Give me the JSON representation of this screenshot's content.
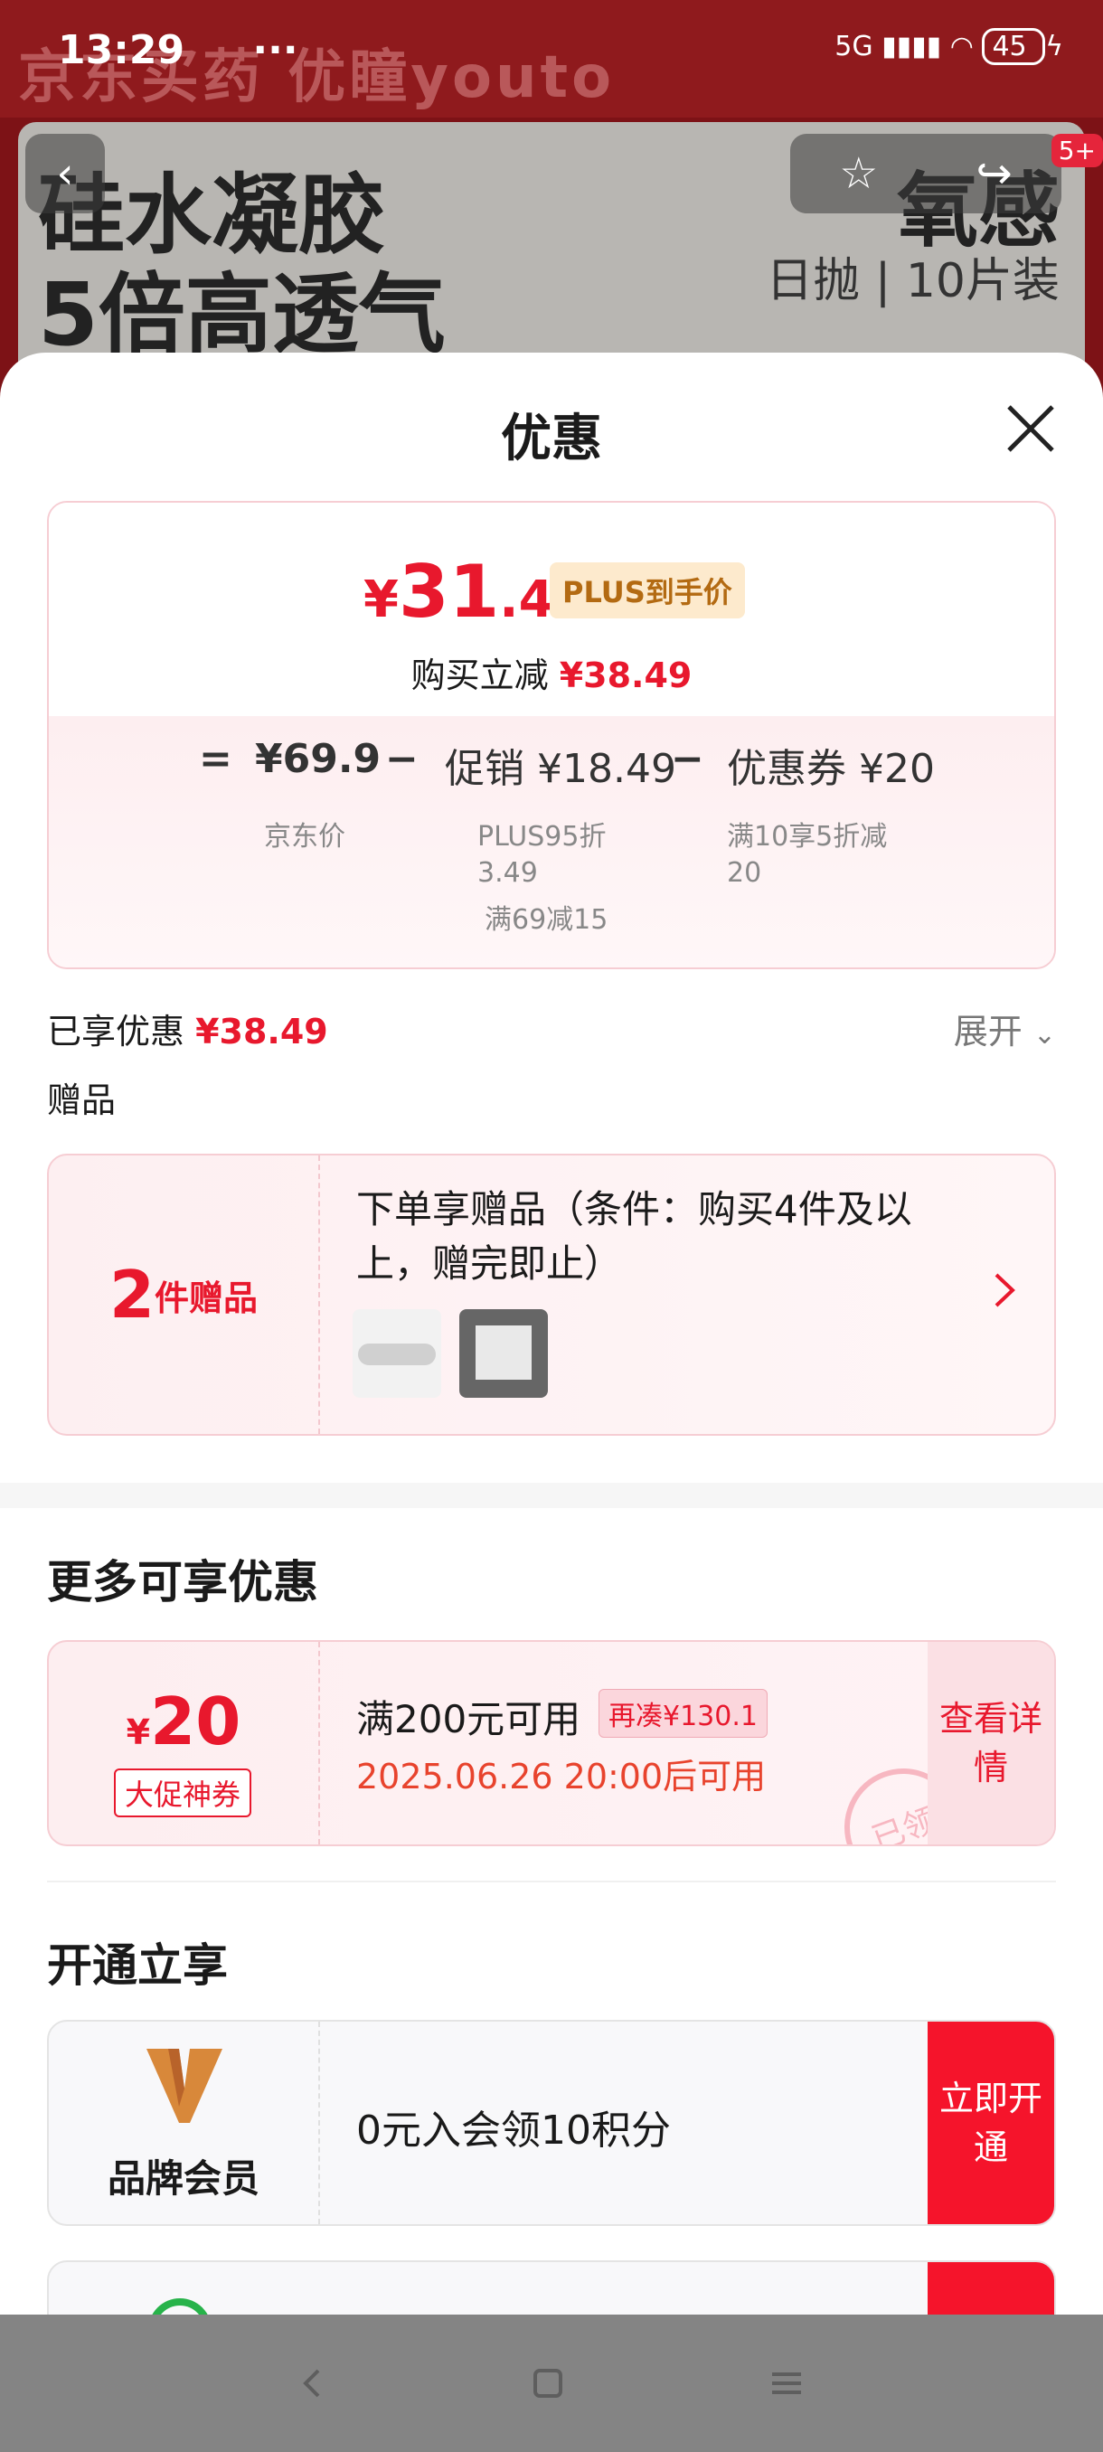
{
  "status_bar": {
    "time": "13:29",
    "dots": "···",
    "network": "5G",
    "battery": "45"
  },
  "banner": {
    "brand": "京东买药 优瞳youto",
    "headline1": "硅水凝胶",
    "headline2": "5倍高透气",
    "oxy": "氧感",
    "daily": "日抛 | 10片装",
    "badge": "5+"
  },
  "sheet": {
    "title": "优惠",
    "final_price": {
      "yen": "¥",
      "int": "31",
      "dec": ".41"
    },
    "plus_tag": "PLUS到手价",
    "save_label": "购买立减",
    "save_amount": "¥38.49",
    "breakdown": {
      "eq": "=",
      "jd_price": "¥69.9",
      "jd_price_label": "京东价",
      "minus1": "−",
      "promo": "促销 ¥18.49",
      "promo_detail1": "PLUS95折",
      "promo_detail2": "3.49",
      "promo_detail3": "满69减15",
      "minus2": "−",
      "coupon": "优惠券 ¥20",
      "coupon_detail1": "满10享5折减",
      "coupon_detail2": "20"
    },
    "enjoyed_label": "已享优惠",
    "enjoyed_amount": "¥38.49",
    "expand_label": "展开",
    "gift_section_title": "赠品",
    "gift": {
      "count": "2",
      "unit": "件赠品",
      "desc": "下单享赠品（条件：购买4件及以上，赠完即止）"
    },
    "more_title": "更多可享优惠",
    "coupon_card": {
      "yen": "¥",
      "amount": "20",
      "type": "大促神券",
      "condition": "满200元可用",
      "gap": "再凑¥130.1",
      "time": "2025.06.26 20:00后可用",
      "stamp": "已领",
      "detail_label": "查看详情"
    },
    "open_title": "开通立享",
    "member": {
      "name": "品牌会员",
      "desc": "0元入会领10积分",
      "button": "立即开通"
    }
  },
  "colors": {
    "accent": "#e8182d",
    "button_red": "#f5142b",
    "plus_gold": "#b36a12"
  }
}
